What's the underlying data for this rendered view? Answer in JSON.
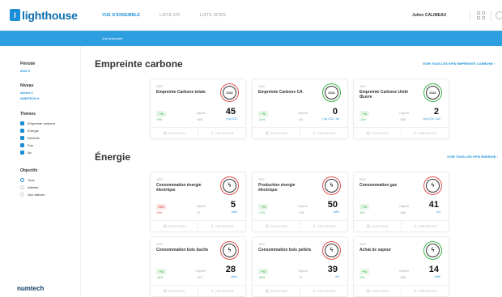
{
  "app": {
    "logo_text": "lighthouse",
    "logo_letter": "l",
    "brand": "numtech"
  },
  "nav": {
    "tabs": [
      "VUE D'ENSEMBLE",
      "LISTE KPI",
      "LISTE SITES"
    ],
    "user": "Julien CALIMEAU"
  },
  "breadcrumb": "Vue ensemble",
  "sidebar": {
    "periode_label": "Période",
    "periode_value": "2022 ▾",
    "niveau_label": "Niveau",
    "niveau_value1": "Atelier  ▾",
    "niveau_value2": "NUMTECH ▾",
    "themes_label": "Thèmes",
    "themes": [
      "Empreinte carbone",
      "Énergie",
      "Déchets",
      "Eau",
      "Air"
    ],
    "objectifs_label": "Objectifs",
    "objectifs": [
      "Tous",
      "Atteints",
      "Non atteints"
    ]
  },
  "sections": [
    {
      "title": "Empreinte carbone",
      "link": "VOIR TOUS LES KPIS EMPREINTE CARBONE  ›"
    },
    {
      "title": "Énergie",
      "link": "VOIR TOUS LES KPIS ÉNERGIE  ›"
    }
  ],
  "cards": [
    {
      "year": "2022",
      "title": "Empreinte Carbone totale",
      "icon": "co2-icon",
      "glyph": "CO2",
      "ring": "red",
      "trend": "−%",
      "trend_pct": "+5%",
      "trend_color": "green",
      "obj_label": "Objectif",
      "obj_val": "<15",
      "value": "45",
      "unit": "t eq CO2",
      "f1": "ÉVOLUTION",
      "f2": "PAR ATELIER"
    },
    {
      "year": "2022",
      "title": "Empreinte Carbone CA",
      "icon": "co2-icon",
      "glyph": "CO2",
      "ring": "green",
      "trend": "−%",
      "trend_pct": "-21%",
      "trend_color": "green",
      "obj_label": "Objectif",
      "obj_val": "<3",
      "value": "0",
      "unit": "t eq CO2 / k€",
      "f1": "ÉVOLUTION",
      "f2": "PAR ATELIER"
    },
    {
      "year": "2022",
      "title": "Empreinte Carbone Unité Œuvre",
      "icon": "co2-icon",
      "glyph": "CO2",
      "ring": "green",
      "trend": "−%",
      "trend_pct": "-13%",
      "trend_color": "green",
      "obj_label": "Objectif",
      "obj_val": "<20",
      "value": "2",
      "unit": "t eq CO2 / UO",
      "f1": "ÉVOLUTION",
      "f2": "PAR ATELIER"
    },
    {
      "year": "2022",
      "title": "Consommation énergie électrique",
      "icon": "lightning-icon",
      "glyph": "ϟ",
      "ring": "red",
      "trend": "+6%",
      "trend_pct": "+6%",
      "trend_color": "red",
      "obj_label": "Objectif",
      "obj_val": "<7",
      "value": "5",
      "unit": "kWh",
      "f1": "ÉVOLUTION",
      "f2": "PAR ATELIER"
    },
    {
      "year": "2022",
      "title": "Production énergie électrique",
      "icon": "lightning-icon",
      "glyph": "ϟ",
      "ring": "red",
      "trend": "−%",
      "trend_pct": "-17%",
      "trend_color": "green",
      "obj_label": "Objectif",
      "obj_val": "<21",
      "value": "50",
      "unit": "kWh",
      "f1": "ÉVOLUTION",
      "f2": "PAR ATELIER"
    },
    {
      "year": "2022",
      "title": "Consommation gaz",
      "icon": "lightning-icon",
      "glyph": "ϟ",
      "ring": "red",
      "trend": "−%",
      "trend_pct": "-6%",
      "trend_color": "green",
      "obj_label": "Objectif",
      "obj_val": "<25",
      "value": "41",
      "unit": "m3",
      "f1": "ÉVOLUTION",
      "f2": "PAR ATELIER"
    },
    {
      "year": "2022",
      "title": "Consommation bois buche",
      "icon": "lightning-icon",
      "glyph": "ϟ",
      "ring": "red",
      "trend": "−%",
      "trend_pct": "-10%",
      "trend_color": "green",
      "obj_label": "Objectif",
      "obj_val": "<27",
      "value": "28",
      "unit": "stère",
      "f1": "ÉVOLUTION",
      "f2": "PAR ATELIER"
    },
    {
      "year": "2022",
      "title": "Consommation bois pellets",
      "icon": "lightning-icon",
      "glyph": "ϟ",
      "ring": "red",
      "trend": "−%",
      "trend_pct": "-40%",
      "trend_color": "green",
      "obj_label": "Objectif",
      "obj_val": "<7",
      "value": "39",
      "unit": "m3",
      "f1": "ÉVOLUTION",
      "f2": "PAR ATELIER"
    },
    {
      "year": "2022",
      "title": "Achat de vapeur",
      "icon": "lightning-icon",
      "glyph": "ϟ",
      "ring": "green",
      "trend": "−%",
      "trend_pct": "-5%",
      "trend_color": "green",
      "obj_label": "Objectif",
      "obj_val": "<28",
      "value": "14",
      "unit": "kWh",
      "f1": "ÉVOLUTION",
      "f2": "PAR ATELIER"
    }
  ],
  "colors": {
    "accent": "#1a8fd8",
    "bluebar": "#2d9ee0",
    "good": "#3bb54a",
    "bad": "#e05050"
  }
}
